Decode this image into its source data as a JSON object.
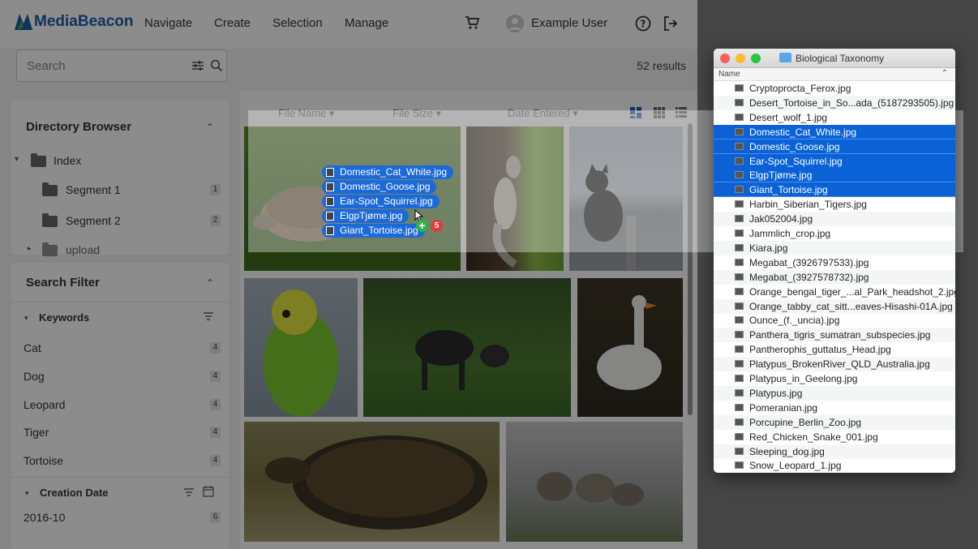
{
  "header": {
    "brand": "MediaBeacon",
    "nav": [
      "Navigate",
      "Create",
      "Selection",
      "Manage"
    ],
    "user": "Example User",
    "icons": [
      "cart-icon",
      "user-avatar-icon",
      "help-icon",
      "logout-icon"
    ]
  },
  "search": {
    "placeholder": "Search",
    "results": "52 results"
  },
  "directory": {
    "title": "Directory Browser",
    "items": [
      {
        "label": "Index",
        "count": ""
      },
      {
        "label": "Segment 1",
        "count": "1"
      },
      {
        "label": "Segment 2",
        "count": "2"
      },
      {
        "label": "upload",
        "count": ""
      }
    ]
  },
  "filter": {
    "title": "Search Filter",
    "keywords_title": "Keywords",
    "keywords": [
      {
        "label": "Cat",
        "count": "4"
      },
      {
        "label": "Dog",
        "count": "4"
      },
      {
        "label": "Leopard",
        "count": "4"
      },
      {
        "label": "Tiger",
        "count": "4"
      },
      {
        "label": "Tortoise",
        "count": "4"
      }
    ],
    "creation_title": "Creation Date",
    "dates": [
      {
        "label": "2016-10",
        "count": "6"
      }
    ]
  },
  "sort": {
    "file_name": "File Name",
    "file_size": "File Size",
    "date_entered": "Date Entered"
  },
  "drag": {
    "files": [
      "Domestic_Cat_White.jpg",
      "Domestic_Goose.jpg",
      "Ear-Spot_Squirrel.jpg",
      "ElgpTjøme.jpg",
      "Giant_Tortoise.jpg"
    ],
    "count": "5"
  },
  "finder": {
    "title": "Biological Taxonomy",
    "column": "Name",
    "files": [
      {
        "name": "Cryptoprocta_Ferox.jpg",
        "selected": false
      },
      {
        "name": "Desert_Tortoise_in_So...ada_(5187293505).jpg",
        "selected": false
      },
      {
        "name": "Desert_wolf_1.jpg",
        "selected": false
      },
      {
        "name": "Domestic_Cat_White.jpg",
        "selected": true
      },
      {
        "name": "Domestic_Goose.jpg",
        "selected": true
      },
      {
        "name": "Ear-Spot_Squirrel.jpg",
        "selected": true
      },
      {
        "name": "ElgpTjøme.jpg",
        "selected": true
      },
      {
        "name": "Giant_Tortoise.jpg",
        "selected": true
      },
      {
        "name": "Harbin_Siberian_Tigers.jpg",
        "selected": false
      },
      {
        "name": "Jak052004.jpg",
        "selected": false
      },
      {
        "name": "Jammlich_crop.jpg",
        "selected": false
      },
      {
        "name": "Kiara.jpg",
        "selected": false
      },
      {
        "name": "Megabat_(3926797533).jpg",
        "selected": false
      },
      {
        "name": "Megabat_(3927578732).jpg",
        "selected": false
      },
      {
        "name": "Orange_bengal_tiger_...al_Park_headshot_2.jpg",
        "selected": false
      },
      {
        "name": "Orange_tabby_cat_sitt...eaves-Hisashi-01A.jpg",
        "selected": false
      },
      {
        "name": "Ounce_(f._uncia).jpg",
        "selected": false
      },
      {
        "name": "Panthera_tigris_sumatran_subspecies.jpg",
        "selected": false
      },
      {
        "name": "Pantherophis_guttatus_Head.jpg",
        "selected": false
      },
      {
        "name": "Platypus_BrokenRiver_QLD_Australia.jpg",
        "selected": false
      },
      {
        "name": "Platypus_in_Geelong.jpg",
        "selected": false
      },
      {
        "name": "Platypus.jpg",
        "selected": false
      },
      {
        "name": "Pomeranian.jpg",
        "selected": false
      },
      {
        "name": "Porcupine_Berlin_Zoo.jpg",
        "selected": false
      },
      {
        "name": "Red_Chicken_Snake_001.jpg",
        "selected": false
      },
      {
        "name": "Sleeping_dog.jpg",
        "selected": false
      },
      {
        "name": "Snow_Leopard_1.jpg",
        "selected": false
      }
    ]
  },
  "colors": {
    "accent": "#1a5fa8",
    "selection": "#0a62d6",
    "add_badge": "#2fb344",
    "count_badge": "#e23b3b"
  }
}
